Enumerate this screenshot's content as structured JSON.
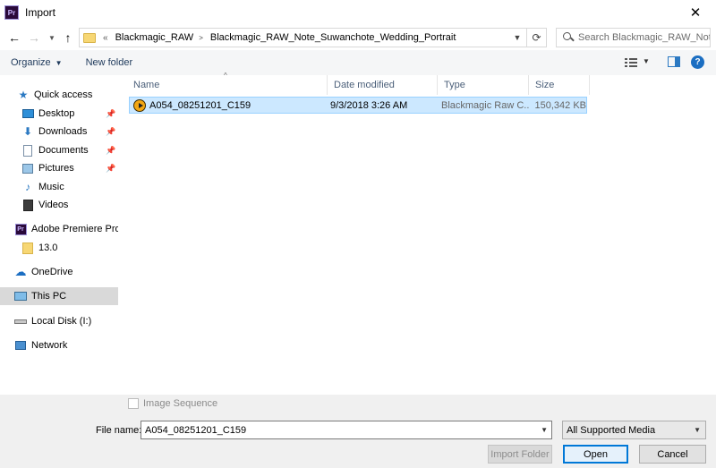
{
  "window": {
    "title": "Import",
    "app_icon_text": "Pr"
  },
  "address": {
    "breadcrumb_overflow": "«",
    "crumbs": [
      "Blackmagic_RAW",
      "Blackmagic_RAW_Note_Suwanchote_Wedding_Portrait"
    ],
    "search_placeholder": "Search Blackmagic_RAW_Not..."
  },
  "toolbar": {
    "organize_label": "Organize",
    "new_folder_label": "New folder"
  },
  "nav": {
    "quick_access": "Quick access",
    "quick_items": [
      {
        "label": "Desktop",
        "pinned": true
      },
      {
        "label": "Downloads",
        "pinned": true
      },
      {
        "label": "Documents",
        "pinned": true
      },
      {
        "label": "Pictures",
        "pinned": true
      },
      {
        "label": "Music",
        "pinned": false
      },
      {
        "label": "Videos",
        "pinned": false
      }
    ],
    "premiere": "Adobe Premiere Pro",
    "premiere_sub": "13.0",
    "onedrive": "OneDrive",
    "this_pc": "This PC",
    "local_disk": "Local Disk (I:)",
    "network": "Network"
  },
  "columns": {
    "name": "Name",
    "date": "Date modified",
    "type": "Type",
    "size": "Size"
  },
  "files": [
    {
      "name": "A054_08251201_C159",
      "date": "9/3/2018 3:26 AM",
      "type": "Blackmagic Raw C...",
      "size": "150,342 KB",
      "selected": true
    }
  ],
  "bottom": {
    "image_sequence_label": "Image Sequence",
    "file_name_label": "File name:",
    "file_name_value": "A054_08251201_C159",
    "file_type_value": "All Supported Media",
    "import_folder_label": "Import Folder",
    "open_label": "Open",
    "cancel_label": "Cancel"
  }
}
